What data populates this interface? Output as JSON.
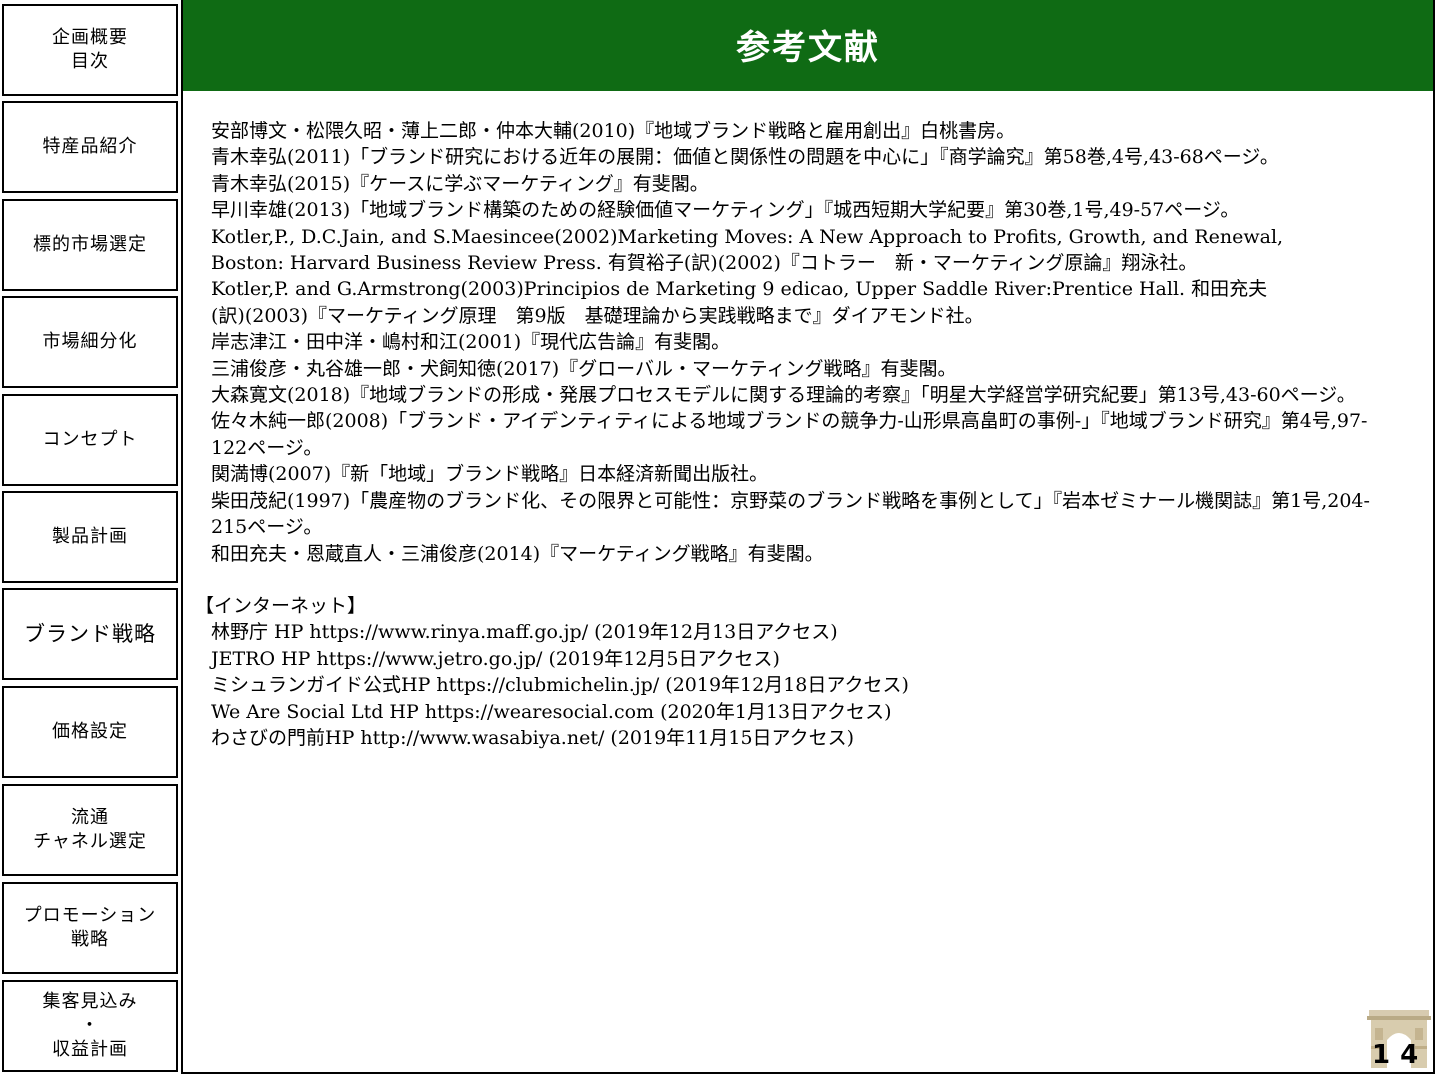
{
  "sidebar": {
    "items": [
      {
        "lines": [
          "企画概要",
          "目次"
        ]
      },
      {
        "lines": [
          "特産品紹介",
          ""
        ]
      },
      {
        "lines": [
          "標的市場選定",
          ""
        ]
      },
      {
        "lines": [
          "市場細分化",
          ""
        ]
      },
      {
        "lines": [
          "コンセプト",
          ""
        ]
      },
      {
        "lines": [
          "製品計画",
          ""
        ]
      },
      {
        "lines": [
          "ブランド戦略",
          ""
        ]
      },
      {
        "lines": [
          "価格設定",
          ""
        ]
      },
      {
        "lines": [
          "流通",
          "チャネル選定"
        ]
      },
      {
        "lines": [
          "プロモーション",
          "戦略"
        ]
      },
      {
        "lines": [
          "集客見込み",
          "・",
          "収益計画"
        ]
      }
    ]
  },
  "header": {
    "title": "参考文献"
  },
  "references": [
    {
      "text": "安部博文・松隈久昭・薄上二郎・仲本大輔(2010)『地域ブランド戦略と雇用創出』白桃書房。",
      "cont": ""
    },
    {
      "text": "青木幸弘(2011)「ブランド研究における近年の展開：価値と関係性の問題を中心に」『商学論究』第58巻,4号,43-68ページ。",
      "cont": ""
    },
    {
      "text": "青木幸弘(2015)『ケースに学ぶマーケティング』有斐閣。",
      "cont": ""
    },
    {
      "text": "早川幸雄(2013)「地域ブランド構築のための経験価値マーケティング」『城西短期大学紀要』第30巻,1号,49-57ページ。",
      "cont": ""
    },
    {
      "text": "Kotler,P., D.C.Jain, and S.Maesincee(2002)Marketing Moves: A New Approach to Profits, Growth, and Renewal,",
      "cont": "Boston: Harvard Business Review Press. 有賀裕子(訳)(2002)『コトラー　新・マーケティング原論』翔泳社。"
    },
    {
      "text": "Kotler,P. and G.Armstrong(2003)Principios de Marketing 9 edicao, Upper Saddle River:Prentice Hall. 和田充夫",
      "cont": "(訳)(2003)『マーケティング原理　第9版　基礎理論から実践戦略まで』ダイアモンド社。"
    },
    {
      "text": "岸志津江・田中洋・嶋村和江(2001)『現代広告論』有斐閣。",
      "cont": ""
    },
    {
      "text": "三浦俊彦・丸谷雄一郎・犬飼知徳(2017)『グローバル・マーケティング戦略』有斐閣。",
      "cont": ""
    },
    {
      "text": "大森寛文(2018)『地域ブランドの形成・発展プロセスモデルに関する理論的考察』「明星大学経営学研究紀要」第13号,43-60ページ。",
      "cont": ""
    },
    {
      "text": "佐々木純一郎(2008)「ブランド・アイデンティティによる地域ブランドの競争力-山形県高畠町の事例-」『地域ブランド研究』第4号,97-",
      "cont": "122ページ。"
    },
    {
      "text": "関満博(2007)『新「地域」ブランド戦略』日本経済新聞出版社。",
      "cont": ""
    },
    {
      "text": "柴田茂紀(1997)「農産物のブランド化、その限界と可能性：京野菜のブランド戦略を事例として」『岩本ゼミナール機関誌』第1号,204-",
      "cont": "215ページ。"
    },
    {
      "text": "和田充夫・恩蔵直人・三浦俊彦(2014)『マーケティング戦略』有斐閣。",
      "cont": ""
    }
  ],
  "internet": {
    "heading": "【インターネット】",
    "items": [
      "林野庁 HP https://www.rinya.maff.go.jp/ (2019年12月13日アクセス)",
      "JETRO HP https://www.jetro.go.jp/ (2019年12月5日アクセス)",
      "ミシュランガイド公式HP https://clubmichelin.jp/ (2019年12月18日アクセス)",
      "We Are Social Ltd HP https://wearesocial.com (2020年1月13日アクセス)",
      "わさびの門前HP http://www.wasabiya.net/ (2019年11月15日アクセス)"
    ]
  },
  "footer": {
    "page_number": "14",
    "logo_icon": "arc-de-triomphe-icon"
  },
  "colors": {
    "title_bar": "#0f6b14",
    "title_text": "#ffffff",
    "border": "#000000"
  }
}
